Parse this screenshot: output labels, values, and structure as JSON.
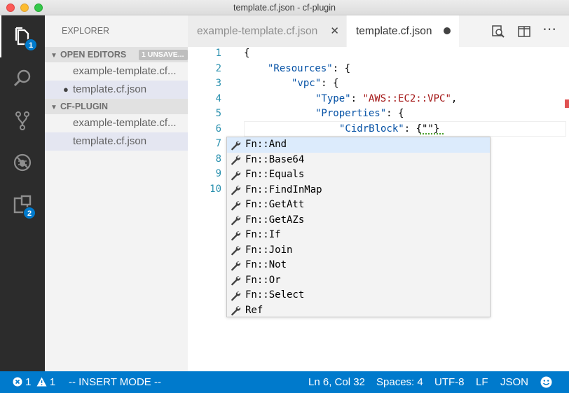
{
  "window": {
    "title": "template.cf.json - cf-plugin"
  },
  "activity_bar": {
    "explorer_badge": "1",
    "extensions_badge": "2"
  },
  "sidebar": {
    "title": "EXPLORER",
    "open_editors": {
      "header": "OPEN EDITORS",
      "unsaved_badge": "1 UNSAVE...",
      "items": [
        {
          "label": "example-template.cf...",
          "modified": false
        },
        {
          "label": "template.cf.json",
          "modified": true
        }
      ]
    },
    "project": {
      "header": "CF-PLUGIN",
      "items": [
        {
          "label": "example-template.cf..."
        },
        {
          "label": "template.cf.json"
        }
      ]
    }
  },
  "tabs": [
    {
      "label": "example-template.cf.json",
      "active": false
    },
    {
      "label": "template.cf.json",
      "active": true,
      "dirty": true
    }
  ],
  "editor": {
    "line_numbers": [
      "1",
      "2",
      "3",
      "4",
      "5",
      "6",
      "7",
      "8",
      "9",
      "10"
    ],
    "lines": {
      "l1": "{",
      "l2_key": "\"Resources\"",
      "l2_rest": ": {",
      "l3_key": "\"vpc\"",
      "l3_rest": ": {",
      "l4_key": "\"Type\"",
      "l4_colon": ": ",
      "l4_val": "\"AWS::EC2::VPC\"",
      "l4_comma": ",",
      "l5_key": "\"Properties\"",
      "l5_rest": ": {",
      "l6_key": "\"CidrBlock\"",
      "l6_rest": ": {\"\"}"
    }
  },
  "suggestions": [
    "Fn::And",
    "Fn::Base64",
    "Fn::Equals",
    "Fn::FindInMap",
    "Fn::GetAtt",
    "Fn::GetAZs",
    "Fn::If",
    "Fn::Join",
    "Fn::Not",
    "Fn::Or",
    "Fn::Select",
    "Ref"
  ],
  "status": {
    "errors": "1",
    "warnings": "1",
    "mode": "-- INSERT MODE --",
    "position": "Ln 6, Col 32",
    "spaces": "Spaces: 4",
    "encoding": "UTF-8",
    "eol": "LF",
    "language": "JSON"
  },
  "colors": {
    "accent": "#007acc",
    "activity_bar": "#2c2c2c",
    "sidebar": "#f3f3f3",
    "string": "#a31515",
    "key": "#0451a5",
    "line_number": "#2b91af"
  }
}
